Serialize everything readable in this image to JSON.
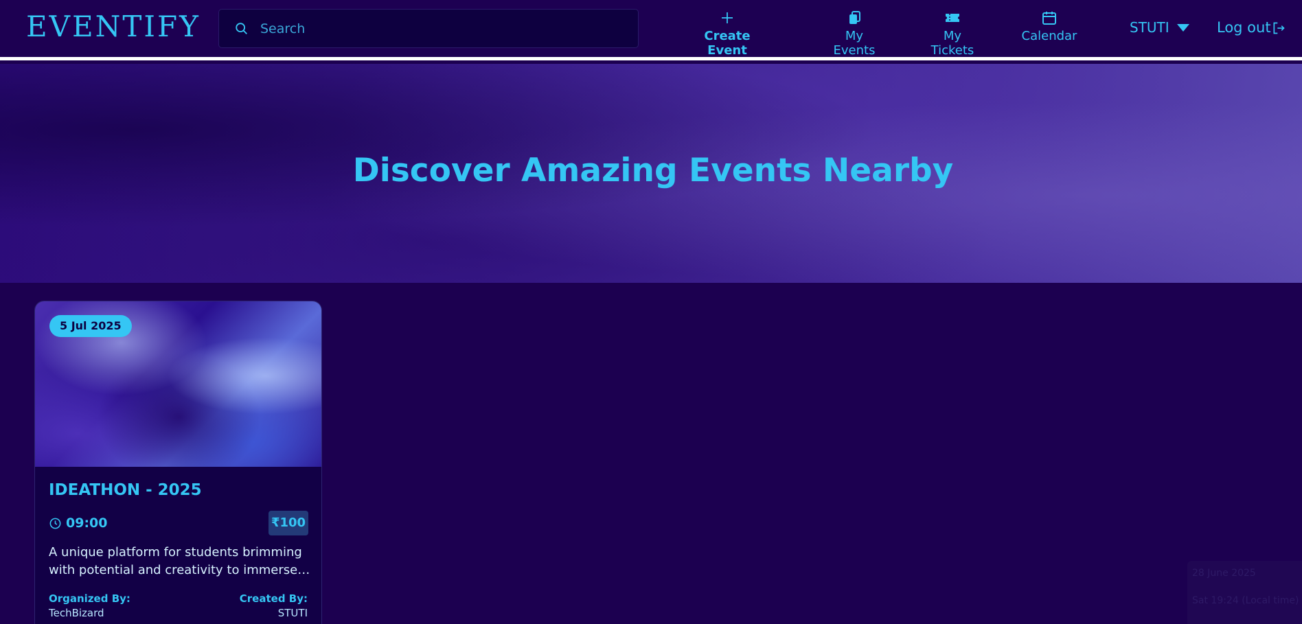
{
  "navbar": {
    "logo": "EVENTIFY",
    "search": {
      "placeholder": "Search",
      "value": ""
    },
    "items": [
      {
        "label": "Create Event",
        "icon": "plus-icon"
      },
      {
        "label": "My Events",
        "icon": "events-icon"
      },
      {
        "label": "My Tickets",
        "icon": "ticket-icon"
      },
      {
        "label": "Calendar",
        "icon": "calendar-icon"
      }
    ],
    "user": "STUTI",
    "logout": "Log out"
  },
  "hero": {
    "title": "Discover Amazing Events Nearby"
  },
  "events": [
    {
      "date": "5 Jul 2025",
      "title": "IDEATHON - 2025",
      "time": "09:00",
      "price": "₹100",
      "description": "A unique platform for students brimming with potential and creativity to immerse…",
      "organized_by_label": "Organized By:",
      "organized_by": "TechBizard",
      "created_by_label": "Created By:",
      "created_by": "STUTI"
    }
  ],
  "clock": {
    "date": "28 June 2025",
    "time": "Sat 19:24 (Local time)"
  },
  "colors": {
    "background": "#1c0050",
    "accent": "#35c6f4",
    "badge": "#35c6f4"
  }
}
